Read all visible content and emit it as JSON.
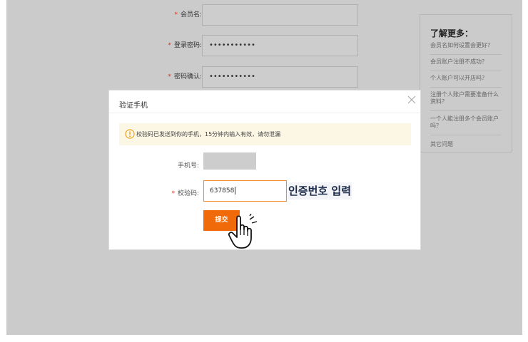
{
  "form": {
    "member_name_label": "会员名:",
    "login_password_label": "登录密码:",
    "login_password_value": "•••••••••••",
    "confirm_password_label": "密码确认:",
    "confirm_password_value": "•••••••••••",
    "required_mark": "*"
  },
  "help": {
    "title": "了解更多：",
    "items": [
      "会员名如何设置会更好？",
      "会员账户注册不成功？",
      "个人账户可以开店吗？",
      "注册个人账户需要准备什么资料？",
      "一个人能注册多个会员账户吗？",
      "其它问题"
    ]
  },
  "modal": {
    "title": "验证手机",
    "notice": "校验码已发送到你的手机，15分钟内输入有效，请勿泄漏",
    "phone_label": "手机号:",
    "code_label": "校验码:",
    "code_value": "637858",
    "submit_label": "提交",
    "annotation": "인증번호 입력"
  },
  "colors": {
    "accent": "#f06a0a",
    "required": "#e0311a",
    "notice_bg": "#fcf6e4",
    "overlay": "#cbcbcb"
  }
}
